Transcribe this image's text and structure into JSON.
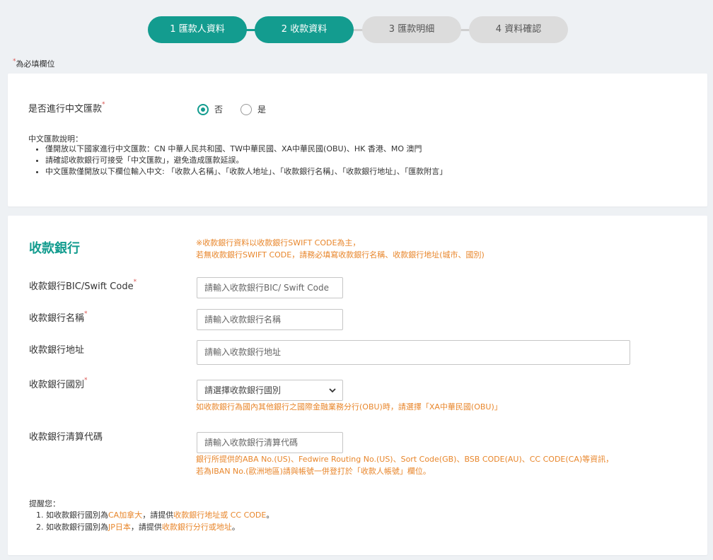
{
  "steps": [
    {
      "label": "1 匯款人資料",
      "state": "active"
    },
    {
      "label": "2 收款資料",
      "state": "active"
    },
    {
      "label": "3 匯款明細",
      "state": "inactive"
    },
    {
      "label": "4 資料確認",
      "state": "inactive"
    }
  ],
  "required_note": "為必填欄位",
  "chinese_remit": {
    "question": "是否進行中文匯款",
    "options": [
      {
        "label": "否",
        "checked": true
      },
      {
        "label": "是",
        "checked": false
      }
    ],
    "desc_title": "中文匯款說明：",
    "desc_items": [
      "僅開放以下國家進行中文匯款：CN 中華人民共和國、TW中華民國、XA中華民國(OBU)、HK 香港、MO 澳門",
      "請確認收款銀行可接受「中文匯款」，避免造成匯款延誤。",
      "中文匯款僅開放以下欄位輸入中文: 「收款人名稱」、「收款人地址」、「收款銀行名稱」、「收款銀行地址」、「匯款附言」"
    ]
  },
  "bank": {
    "title": "收款銀行",
    "notice_line1": "※收款銀行資料以收款銀行SWIFT CODE為主，",
    "notice_line2": "若無收款銀行SWIFT CODE，請務必填寫收款銀行名稱、收款銀行地址(城市、國別)",
    "swift_label": "收款銀行BIC/Swift Code",
    "swift_placeholder": "請輸入收款銀行BIC/ Swift Code",
    "name_label": "收款銀行名稱",
    "name_placeholder": "請輸入收款銀行名稱",
    "address_label": "收款銀行地址",
    "address_placeholder": "請輸入收款銀行地址",
    "country_label": "收款銀行國別",
    "country_selected": "請選擇收款銀行國別",
    "country_hint": "如收款銀行為國內其他銀行之國際金融業務分行(OBU)時，請選擇「XA中華民國(OBU)」",
    "clearing_label": "收款銀行清算代碼",
    "clearing_placeholder": "請輸入收款銀行清算代碼",
    "clearing_hint1": "銀行所提供的ABA No.(US)、Fedwire Routing No.(US)、Sort Code(GB)、BSB CODE(AU)、CC CODE(CA)等資訊，",
    "clearing_hint2": "若為IBAN No.(歐洲地區)請與帳號一併登打於「收款人帳號」欄位。"
  },
  "reminder": {
    "title": "提醒您：",
    "item1_pre": "1. 如收款銀行國別為",
    "item1_country": "CA加拿大",
    "item1_mid": "，請提供",
    "item1_req": "收款銀行地址或 CC CODE",
    "item1_end": "。",
    "item2_pre": "2. 如收款銀行國別為",
    "item2_country": "JP日本",
    "item2_mid": "，請提供",
    "item2_req": "收款銀行分行或地址",
    "item2_end": "。"
  },
  "colors": {
    "accent": "#139c8f",
    "warning": "#e8862b",
    "required": "#d9534f"
  }
}
